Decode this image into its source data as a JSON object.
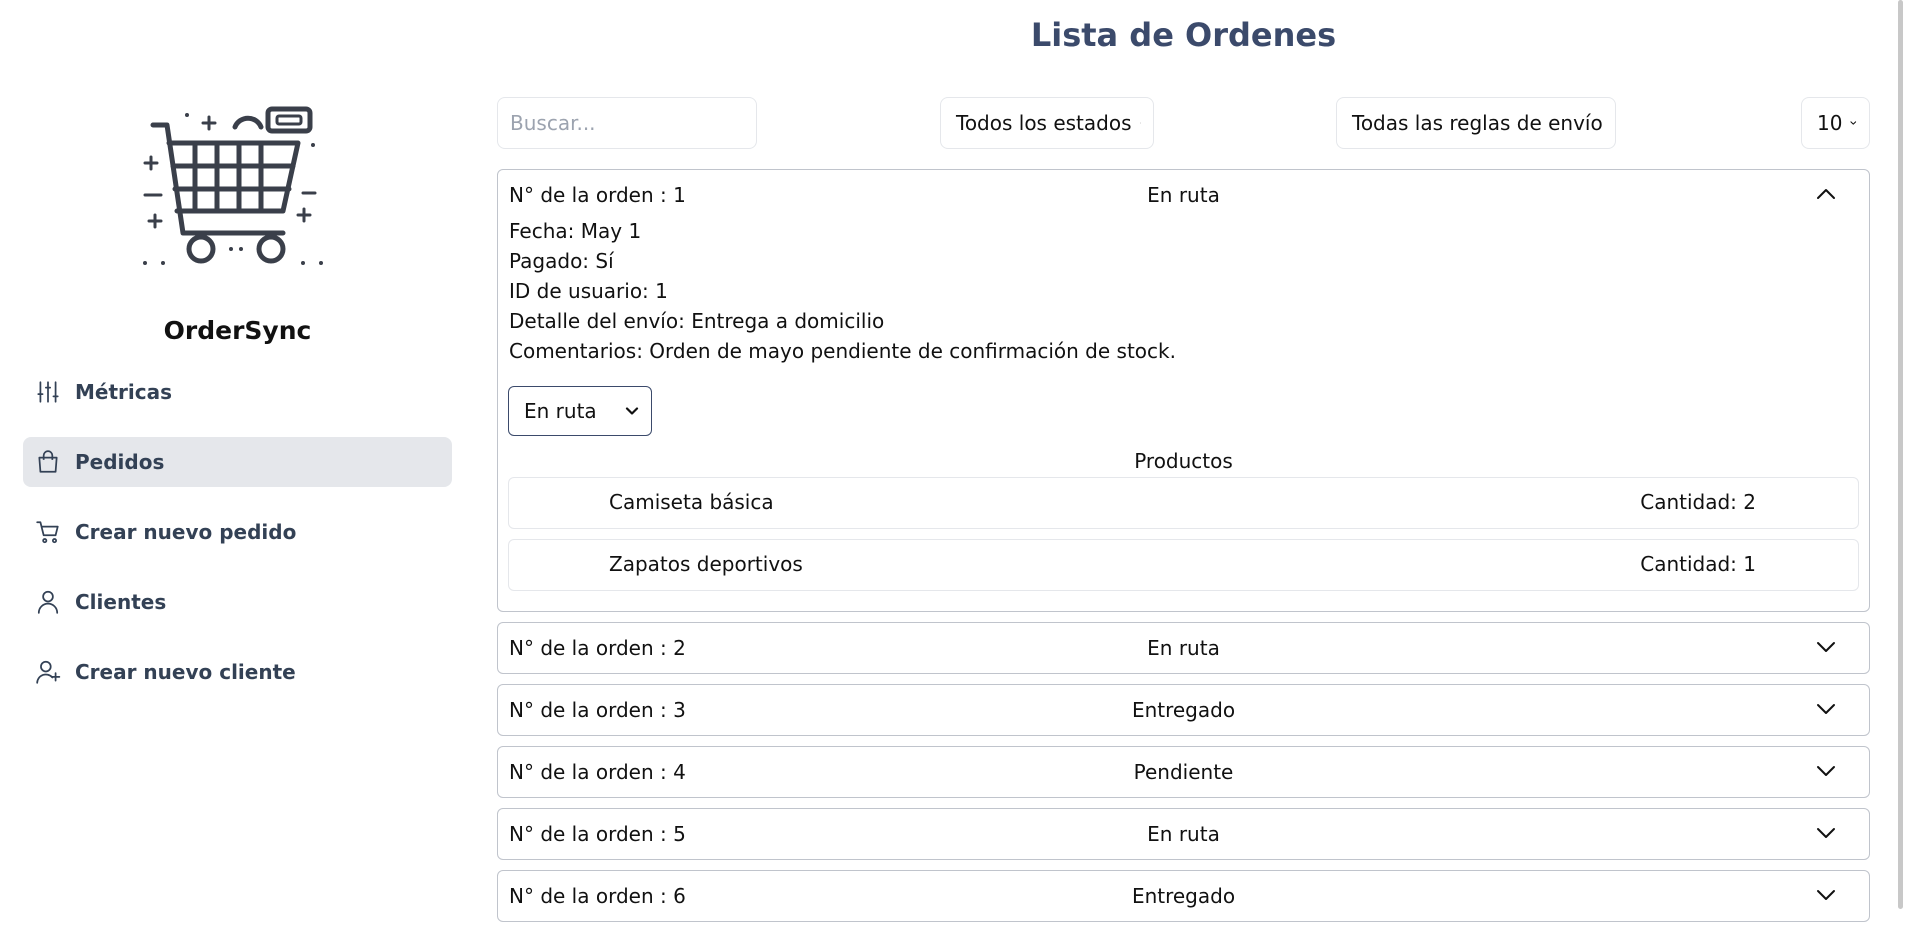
{
  "app": {
    "name": "OrderSync"
  },
  "sidebar": {
    "items": [
      {
        "label": "Métricas",
        "icon": "sliders-icon",
        "active": false
      },
      {
        "label": "Pedidos",
        "icon": "shopping-bag-icon",
        "active": true
      },
      {
        "label": "Crear nuevo pedido",
        "icon": "cart-icon",
        "active": false
      },
      {
        "label": "Clientes",
        "icon": "user-icon",
        "active": false
      },
      {
        "label": "Crear nuevo cliente",
        "icon": "user-plus-icon",
        "active": false
      }
    ]
  },
  "main": {
    "title": "Lista de Ordenes",
    "filters": {
      "search_placeholder": "Buscar...",
      "status_filter": "Todos los estados",
      "shipping_filter": "Todas las reglas de envío",
      "page_size": "10"
    },
    "expanded_order": {
      "number_label": "N° de la orden : 1",
      "status": "En ruta",
      "date": "Fecha: May 1",
      "paid": "Pagado: Sí",
      "user_id": "ID de usuario: 1",
      "shipping": "Detalle del envío: Entrega a domicilio",
      "comments": "Comentarios: Orden de mayo pendiente de confirmación de stock.",
      "status_select": "En ruta",
      "products_title": "Productos",
      "products": [
        {
          "name": "Camiseta básica",
          "qty": "Cantidad: 2"
        },
        {
          "name": "Zapatos deportivos",
          "qty": "Cantidad: 1"
        }
      ]
    },
    "orders": [
      {
        "number_label": "N° de la orden : 2",
        "status": "En ruta"
      },
      {
        "number_label": "N° de la orden : 3",
        "status": "Entregado"
      },
      {
        "number_label": "N° de la orden : 4",
        "status": "Pendiente"
      },
      {
        "number_label": "N° de la orden : 5",
        "status": "En ruta"
      },
      {
        "number_label": "N° de la orden : 6",
        "status": "Entregado"
      }
    ]
  },
  "colors": {
    "title": "#3b4a6b",
    "nav_text": "#334155",
    "active_bg": "#e5e7eb"
  }
}
